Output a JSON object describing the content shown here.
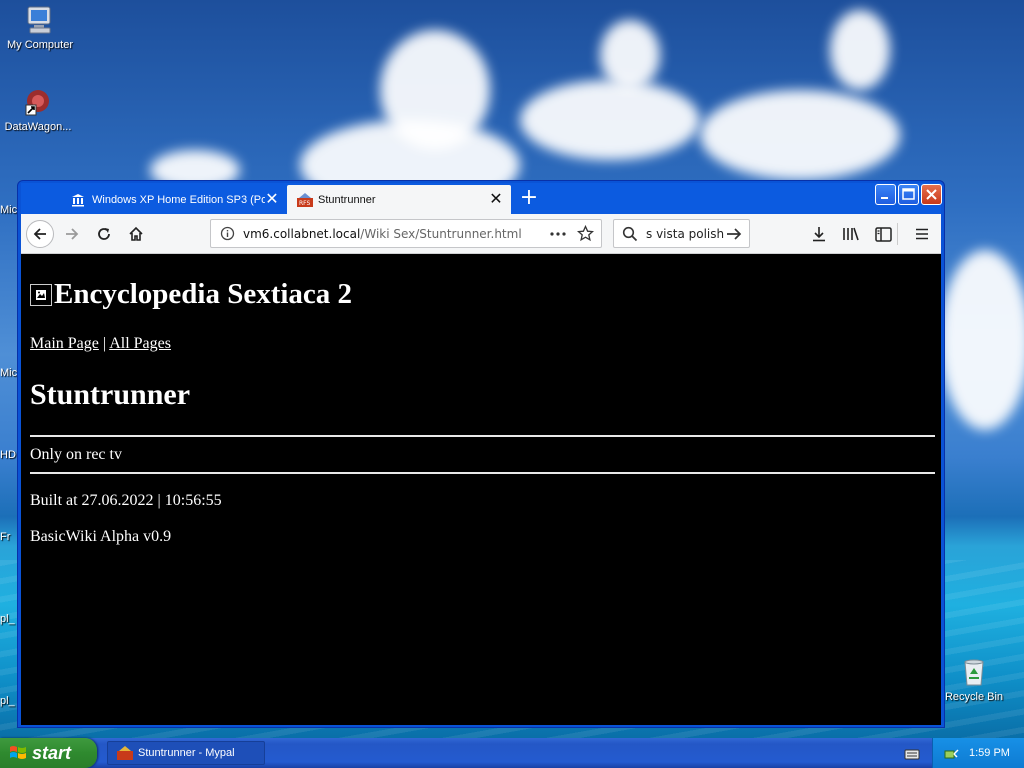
{
  "desktop": {
    "icons": [
      {
        "label": "My Computer",
        "icon": "computer-icon"
      },
      {
        "label": "DataWagon...",
        "icon": "shortcut-icon"
      },
      {
        "label": "Recycle Bin",
        "icon": "recycle-bin-icon"
      }
    ],
    "partial_labels": [
      "Mic",
      "Mic",
      "HD",
      "Fr",
      "pl_",
      "pl_"
    ]
  },
  "browser": {
    "tabs": [
      {
        "title": "Windows XP Home Edition SP3 (Po",
        "icon": "library-icon",
        "active": false
      },
      {
        "title": "Stuntrunner",
        "icon": "site-favicon",
        "active": true
      }
    ],
    "new_tab_label": "+",
    "url_base": "vm6.collabnet.local",
    "url_path": "/Wiki Sex/Stuntrunner.html",
    "search_value": "s vista polish",
    "toolbar_icons": [
      "back-icon",
      "forward-icon",
      "reload-icon",
      "home-icon",
      "info-icon",
      "more-icon",
      "bookmark-star-icon",
      "search-icon",
      "go-arrow-icon",
      "download-icon",
      "library-icon",
      "sidebar-icon",
      "menu-icon"
    ]
  },
  "page": {
    "site_title": "Encyclopedia Sextiaca 2",
    "nav_link_main": "Main Page",
    "nav_separator": "|",
    "nav_link_all": "All Pages",
    "article_title": "Stuntrunner",
    "article_body": "Only on rec tv",
    "built_at": "Built at 27.06.2022 | 10:56:55",
    "engine": "BasicWiki Alpha v0.9"
  },
  "taskbar": {
    "start_label": "start",
    "task_item": "Stuntrunner - Mypal",
    "clock": "1:59 PM"
  },
  "colors": {
    "title_bar": "#0a53d6",
    "page_background": "#000000",
    "page_text": "#ffffff",
    "start_button": "#3a953a",
    "tray": "#1790e6"
  }
}
